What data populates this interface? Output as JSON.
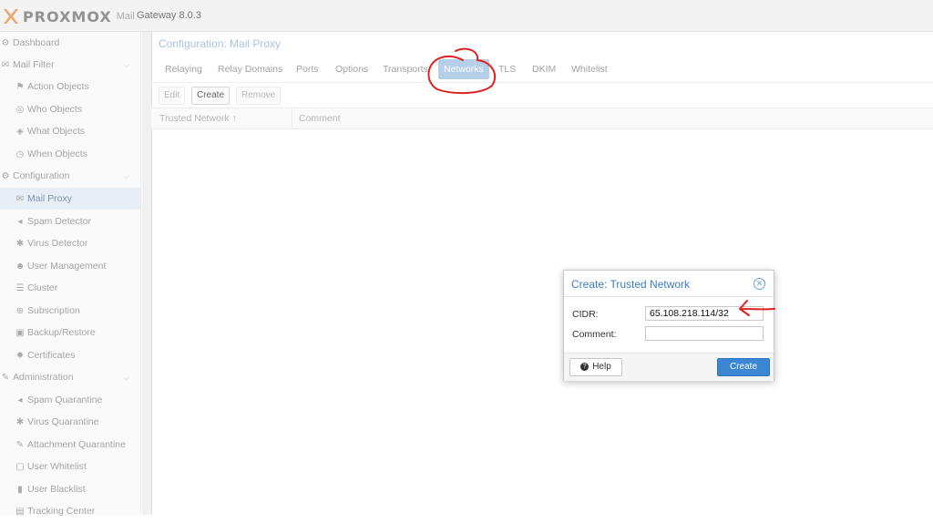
{
  "header": {
    "logo_text": "PROXMOX",
    "product": "Mail",
    "version": "Gateway 8.0.3"
  },
  "sidebar": {
    "items": [
      {
        "label": "Dashboard",
        "icon": "dashboard-icon"
      },
      {
        "label": "Mail Filter",
        "icon": "envelope-icon"
      },
      {
        "label": "Action Objects",
        "icon": "flag-icon"
      },
      {
        "label": "Who Objects",
        "icon": "user-circle-icon"
      },
      {
        "label": "What Objects",
        "icon": "cube-icon"
      },
      {
        "label": "When Objects",
        "icon": "clock-icon"
      },
      {
        "label": "Configuration",
        "icon": "gears-icon"
      },
      {
        "label": "Mail Proxy",
        "icon": "envelope-outline-icon"
      },
      {
        "label": "Spam Detector",
        "icon": "bullhorn-icon"
      },
      {
        "label": "Virus Detector",
        "icon": "bug-icon"
      },
      {
        "label": "User Management",
        "icon": "users-icon"
      },
      {
        "label": "Cluster",
        "icon": "server-icon"
      },
      {
        "label": "Subscription",
        "icon": "support-icon"
      },
      {
        "label": "Backup/Restore",
        "icon": "floppy-icon"
      },
      {
        "label": "Certificates",
        "icon": "certificate-icon"
      },
      {
        "label": "Administration",
        "icon": "wrench-icon"
      },
      {
        "label": "Spam Quarantine",
        "icon": "bullhorn-icon"
      },
      {
        "label": "Virus Quarantine",
        "icon": "bug-icon"
      },
      {
        "label": "Attachment Quarantine",
        "icon": "paperclip-icon"
      },
      {
        "label": "User Whitelist",
        "icon": "file-icon"
      },
      {
        "label": "User Blacklist",
        "icon": "file-solid-icon"
      },
      {
        "label": "Tracking Center",
        "icon": "list-icon"
      }
    ],
    "selected": "Mail Proxy"
  },
  "main": {
    "title": "Configuration: Mail Proxy",
    "tabs": [
      "Relaying",
      "Relay Domains",
      "Ports",
      "Options",
      "Transports",
      "Networks",
      "TLS",
      "DKIM",
      "Whitelist"
    ],
    "active_tab": "Networks",
    "toolbar": {
      "edit": "Edit",
      "create": "Create",
      "remove": "Remove"
    },
    "grid": {
      "columns": [
        "Trusted Network ↑",
        "Comment"
      ]
    }
  },
  "dialog": {
    "title": "Create: Trusted Network",
    "cidr_label": "CIDR:",
    "cidr_value": "65.108.218.114/32",
    "comment_label": "Comment:",
    "comment_value": "",
    "help_label": "Help",
    "create_label": "Create"
  },
  "colors": {
    "accent": "#3b87d4",
    "annotation": "#e02020",
    "selected_tab": "#b5cfe8"
  }
}
